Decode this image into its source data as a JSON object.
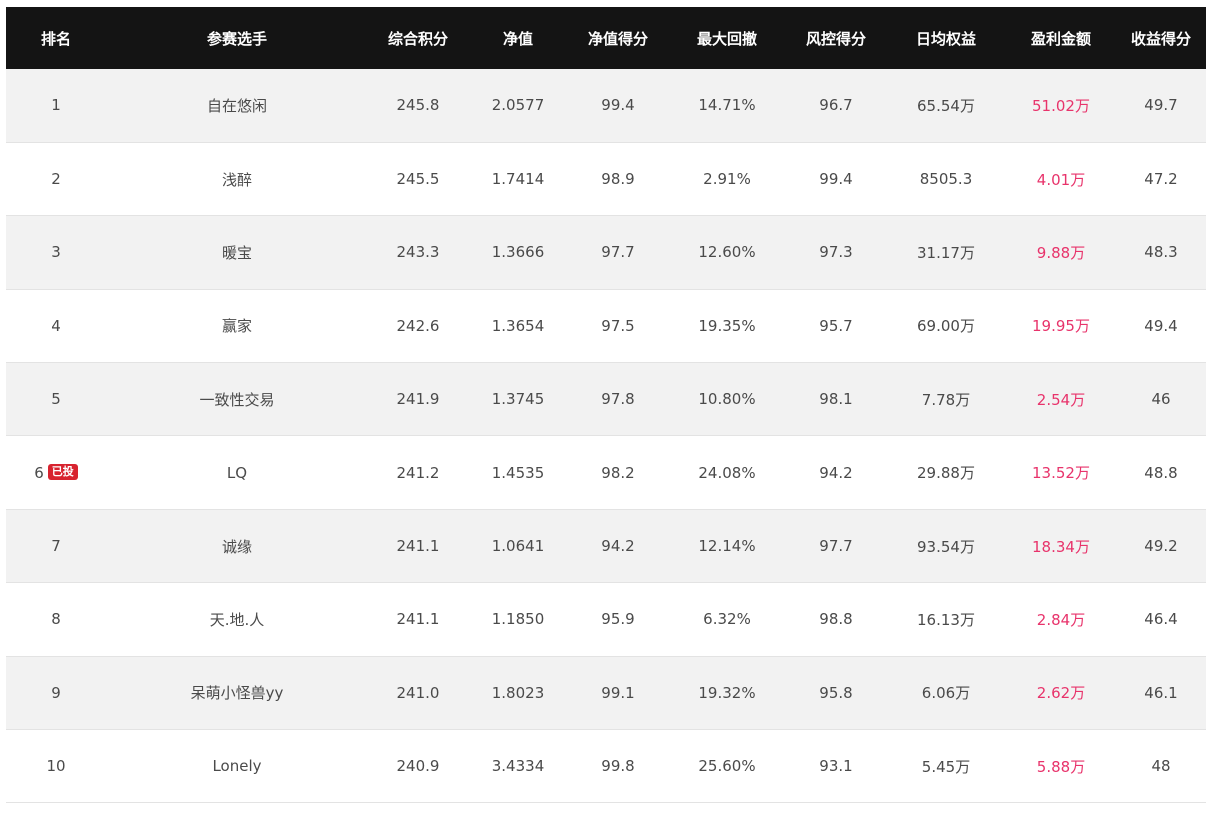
{
  "header": [
    "排名",
    "参赛选手",
    "综合积分",
    "净值",
    "净值得分",
    "最大回撤",
    "风控得分",
    "日均权益",
    "盈利金额",
    "收益得分"
  ],
  "colors": {
    "header_bg": "#141414",
    "profit": "#e8336b",
    "badge": "#d8232f",
    "stripe": "#f2f2f2"
  },
  "rows": [
    {
      "rank": "1",
      "name": "自在悠闲",
      "score": "245.8",
      "nav": "2.0577",
      "nav_score": "99.4",
      "drawdown": "14.71%",
      "risk_score": "96.7",
      "avg_equity": "65.54万",
      "profit": "51.02万",
      "return_score": "49.7",
      "badge": ""
    },
    {
      "rank": "2",
      "name": "浅醉",
      "score": "245.5",
      "nav": "1.7414",
      "nav_score": "98.9",
      "drawdown": "2.91%",
      "risk_score": "99.4",
      "avg_equity": "8505.3",
      "profit": "4.01万",
      "return_score": "47.2",
      "badge": ""
    },
    {
      "rank": "3",
      "name": "暖宝",
      "score": "243.3",
      "nav": "1.3666",
      "nav_score": "97.7",
      "drawdown": "12.60%",
      "risk_score": "97.3",
      "avg_equity": "31.17万",
      "profit": "9.88万",
      "return_score": "48.3",
      "badge": ""
    },
    {
      "rank": "4",
      "name": "赢家",
      "score": "242.6",
      "nav": "1.3654",
      "nav_score": "97.5",
      "drawdown": "19.35%",
      "risk_score": "95.7",
      "avg_equity": "69.00万",
      "profit": "19.95万",
      "return_score": "49.4",
      "badge": ""
    },
    {
      "rank": "5",
      "name": "一致性交易",
      "score": "241.9",
      "nav": "1.3745",
      "nav_score": "97.8",
      "drawdown": "10.80%",
      "risk_score": "98.1",
      "avg_equity": "7.78万",
      "profit": "2.54万",
      "return_score": "46",
      "badge": ""
    },
    {
      "rank": "6",
      "name": "LQ",
      "score": "241.2",
      "nav": "1.4535",
      "nav_score": "98.2",
      "drawdown": "24.08%",
      "risk_score": "94.2",
      "avg_equity": "29.88万",
      "profit": "13.52万",
      "return_score": "48.8",
      "badge": "已投"
    },
    {
      "rank": "7",
      "name": "诚缘",
      "score": "241.1",
      "nav": "1.0641",
      "nav_score": "94.2",
      "drawdown": "12.14%",
      "risk_score": "97.7",
      "avg_equity": "93.54万",
      "profit": "18.34万",
      "return_score": "49.2",
      "badge": ""
    },
    {
      "rank": "8",
      "name": "天.地.人",
      "score": "241.1",
      "nav": "1.1850",
      "nav_score": "95.9",
      "drawdown": "6.32%",
      "risk_score": "98.8",
      "avg_equity": "16.13万",
      "profit": "2.84万",
      "return_score": "46.4",
      "badge": ""
    },
    {
      "rank": "9",
      "name": "呆萌小怪兽yy",
      "score": "241.0",
      "nav": "1.8023",
      "nav_score": "99.1",
      "drawdown": "19.32%",
      "risk_score": "95.8",
      "avg_equity": "6.06万",
      "profit": "2.62万",
      "return_score": "46.1",
      "badge": ""
    },
    {
      "rank": "10",
      "name": "Lonely",
      "score": "240.9",
      "nav": "3.4334",
      "nav_score": "99.8",
      "drawdown": "25.60%",
      "risk_score": "93.1",
      "avg_equity": "5.45万",
      "profit": "5.88万",
      "return_score": "48",
      "badge": ""
    }
  ]
}
